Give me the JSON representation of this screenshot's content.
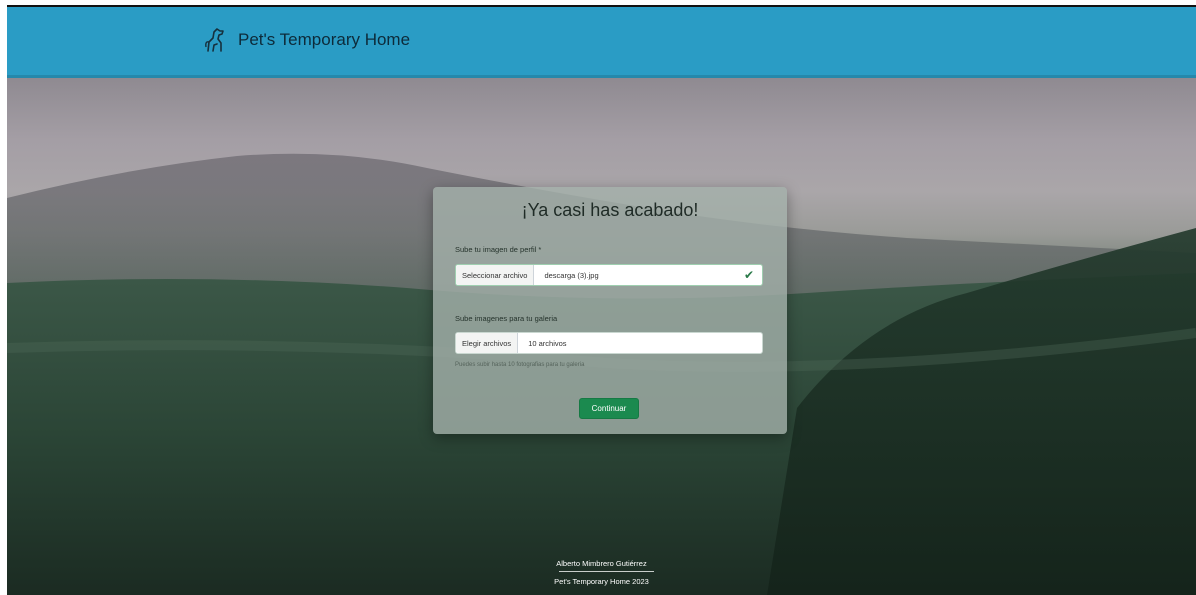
{
  "navbar": {
    "brand_icon": "dog-icon",
    "brand_text": "Pet's Temporary Home",
    "color": "#2a9cc5"
  },
  "form": {
    "title": "¡Ya casi has acabado!",
    "profile_label": "Sube tu imagen de perfil *",
    "profile_button": "Seleccionar archivo",
    "profile_filename": "descarga (3).jpg",
    "profile_status_icon": "check-icon",
    "gallery_label": "Sube imagenes para tu galeria",
    "gallery_button": "Elegir archivos",
    "gallery_filename": "10 archivos",
    "gallery_help": "Puedes subir hasta 10 fotografias para tu galeria",
    "submit_label": "Continuar",
    "submit_color": "#1b8a4f"
  },
  "footer": {
    "author": "Alberto Mimbrero Gutiérrez",
    "copyright": "Pet's Temporary Home 2023"
  }
}
